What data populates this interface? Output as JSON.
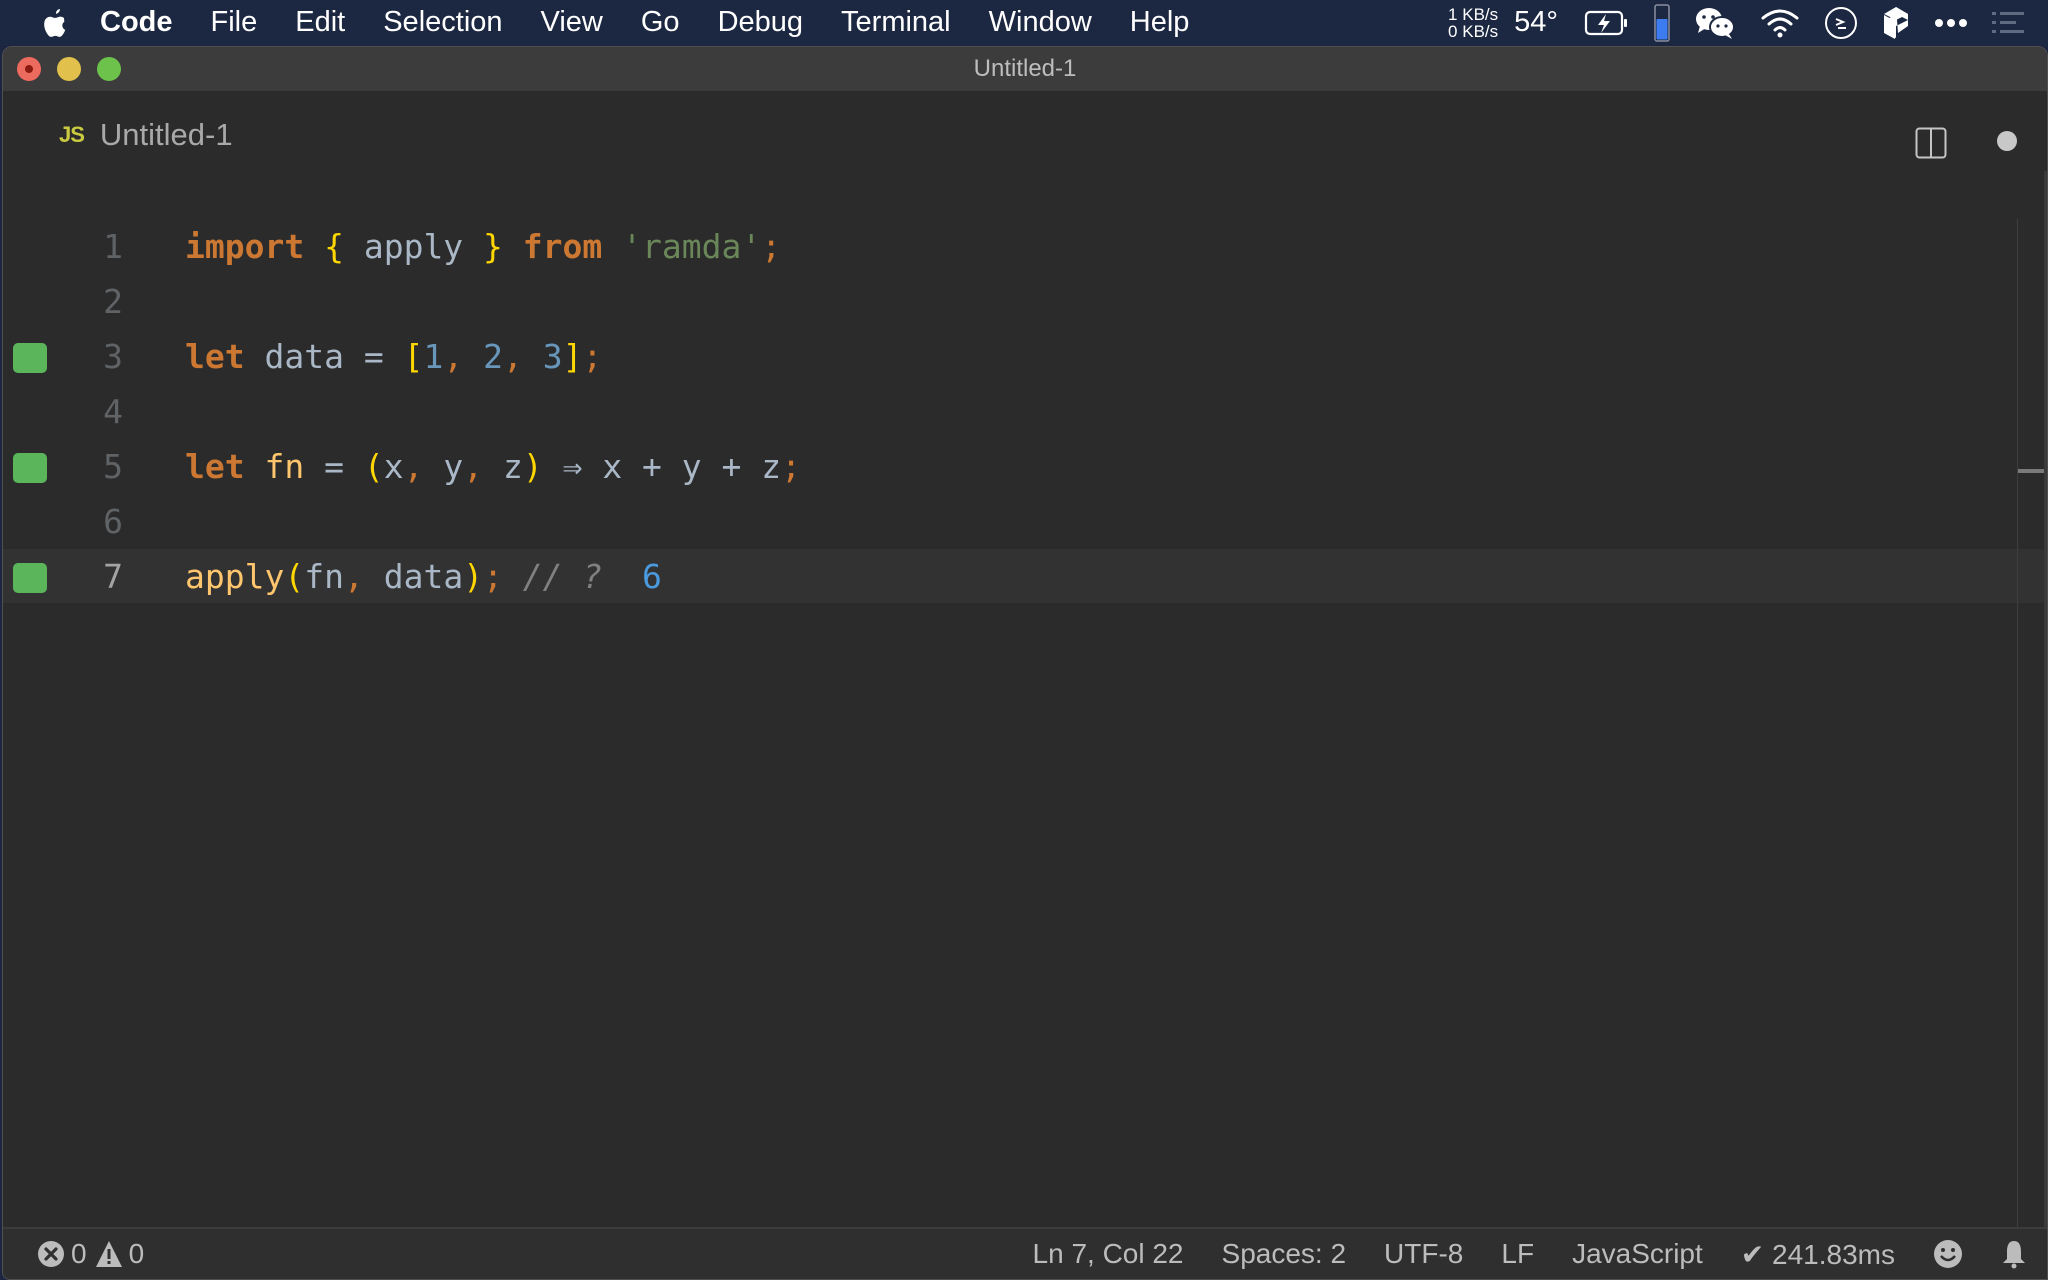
{
  "menubar": {
    "apple_icon": "apple-logo-icon",
    "items": [
      "Code",
      "File",
      "Edit",
      "Selection",
      "View",
      "Go",
      "Debug",
      "Terminal",
      "Window",
      "Help"
    ],
    "net_up": "1 KB/s",
    "net_down": "0 KB/s",
    "temperature": "54°",
    "tray_icons": [
      "battery-charging-icon",
      "battery-level-icon",
      "wechat-icon",
      "wifi-icon",
      "terminal-icon",
      "app-icon",
      "more-icon",
      "list-icon"
    ]
  },
  "window": {
    "title": "Untitled-1",
    "traffic_lights": {
      "close": "#ed6a5e",
      "minimize": "#e2c04c",
      "maximize": "#6cc24a"
    }
  },
  "tab": {
    "icon_label": "JS",
    "label": "Untitled-1",
    "dirty": true
  },
  "editor": {
    "lines": [
      {
        "number": "1",
        "marked": false,
        "current": false,
        "tokens": [
          {
            "t": "import",
            "c": "kw"
          },
          {
            "t": " ",
            "c": "op"
          },
          {
            "t": "{",
            "c": "br"
          },
          {
            "t": " apply ",
            "c": "id"
          },
          {
            "t": "}",
            "c": "br"
          },
          {
            "t": " ",
            "c": "op"
          },
          {
            "t": "from",
            "c": "kw"
          },
          {
            "t": " ",
            "c": "op"
          },
          {
            "t": "'ramda'",
            "c": "str"
          },
          {
            "t": ";",
            "c": "punc"
          }
        ]
      },
      {
        "number": "2",
        "marked": false,
        "current": false,
        "tokens": []
      },
      {
        "number": "3",
        "marked": true,
        "current": false,
        "tokens": [
          {
            "t": "let",
            "c": "kw"
          },
          {
            "t": " data = ",
            "c": "id"
          },
          {
            "t": "[",
            "c": "br"
          },
          {
            "t": "1",
            "c": "num"
          },
          {
            "t": ",",
            "c": "punc"
          },
          {
            "t": " ",
            "c": "op"
          },
          {
            "t": "2",
            "c": "num"
          },
          {
            "t": ",",
            "c": "punc"
          },
          {
            "t": " ",
            "c": "op"
          },
          {
            "t": "3",
            "c": "num"
          },
          {
            "t": "]",
            "c": "br"
          },
          {
            "t": ";",
            "c": "punc"
          }
        ]
      },
      {
        "number": "4",
        "marked": false,
        "current": false,
        "tokens": []
      },
      {
        "number": "5",
        "marked": true,
        "current": false,
        "tokens": [
          {
            "t": "let",
            "c": "kw"
          },
          {
            "t": " ",
            "c": "op"
          },
          {
            "t": "fn",
            "c": "fnname"
          },
          {
            "t": " = ",
            "c": "op"
          },
          {
            "t": "(",
            "c": "br"
          },
          {
            "t": "x",
            "c": "id"
          },
          {
            "t": ",",
            "c": "punc"
          },
          {
            "t": " y",
            "c": "id"
          },
          {
            "t": ",",
            "c": "punc"
          },
          {
            "t": " z",
            "c": "id"
          },
          {
            "t": ")",
            "c": "br"
          },
          {
            "t": " ⇒ x + y + z",
            "c": "op"
          },
          {
            "t": ";",
            "c": "punc"
          }
        ]
      },
      {
        "number": "6",
        "marked": false,
        "current": false,
        "tokens": []
      },
      {
        "number": "7",
        "marked": true,
        "current": true,
        "tokens": [
          {
            "t": "apply",
            "c": "fnname"
          },
          {
            "t": "(",
            "c": "br"
          },
          {
            "t": "fn",
            "c": "id"
          },
          {
            "t": ",",
            "c": "punc"
          },
          {
            "t": " data",
            "c": "id"
          },
          {
            "t": ")",
            "c": "br"
          },
          {
            "t": ";",
            "c": "punc"
          },
          {
            "t": " // ? ",
            "c": "cmt"
          },
          {
            "t": " 6",
            "c": "result"
          }
        ]
      }
    ],
    "gutter_mark_color": "#5bb55b"
  },
  "statusbar": {
    "errors": "0",
    "warnings": "0",
    "cursor": "Ln 7, Col 22",
    "indent": "Spaces: 2",
    "encoding": "UTF-8",
    "eol": "LF",
    "language": "JavaScript",
    "timing": "✔ 241.83ms"
  }
}
